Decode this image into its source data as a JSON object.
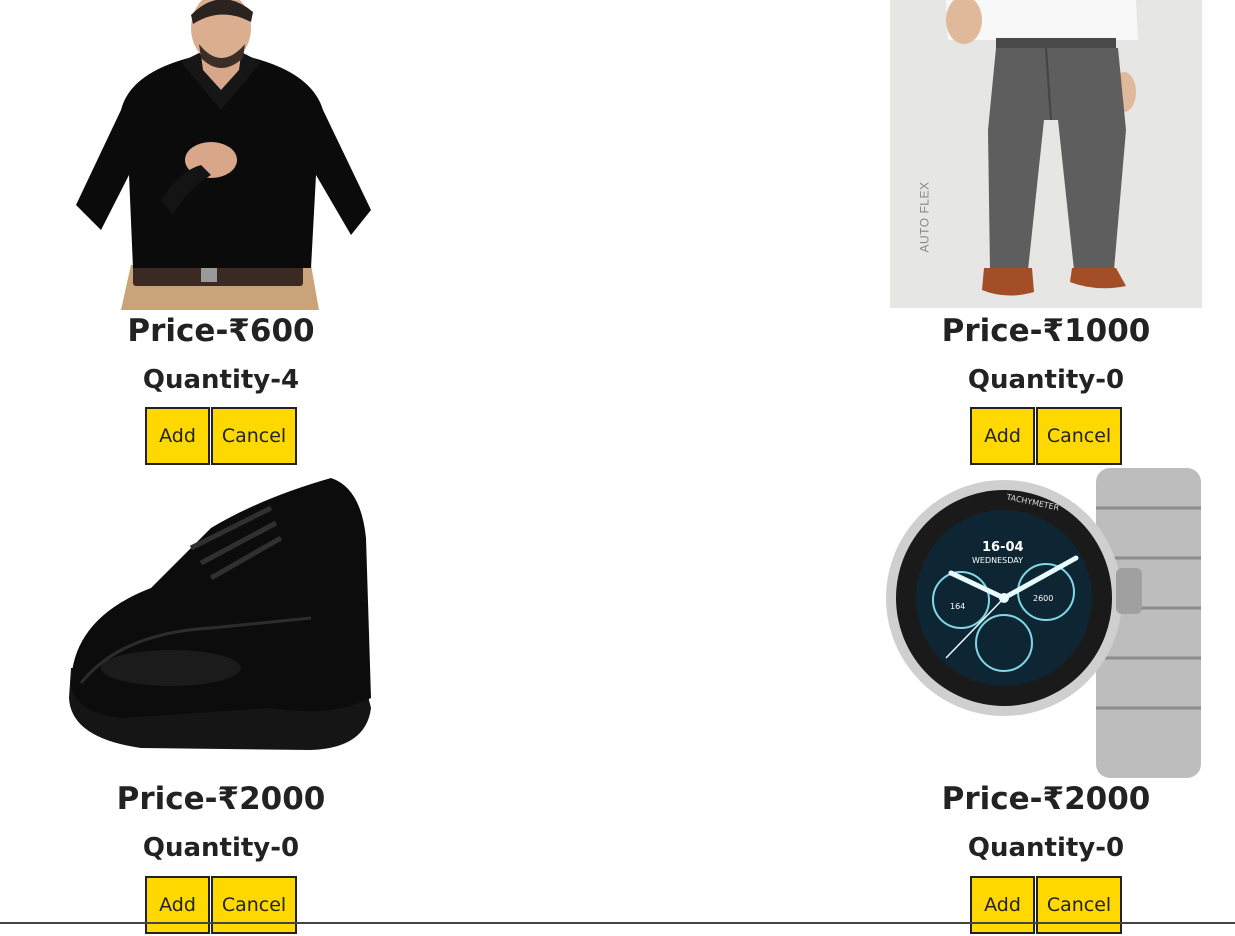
{
  "products": [
    {
      "name": "black-shirt",
      "price": "Price-₹600",
      "quantity": "Quantity-4",
      "add_label": "Add",
      "cancel_label": "Cancel"
    },
    {
      "name": "grey-trousers",
      "price": "Price-₹1000",
      "quantity": "Quantity-0",
      "add_label": "Add",
      "cancel_label": "Cancel",
      "image_text": "AUTO FLEX"
    },
    {
      "name": "black-formal-shoe",
      "price": "Price-₹2000",
      "quantity": "Quantity-0",
      "add_label": "Add",
      "cancel_label": "Cancel"
    },
    {
      "name": "silver-smartwatch",
      "price": "Price-₹2000",
      "quantity": "Quantity-0",
      "add_label": "Add",
      "cancel_label": "Cancel",
      "watch_face": {
        "time": "16-04",
        "day": "WEDNESDAY",
        "bezel": "TACHYMETER",
        "left_dial": "164",
        "right_dial": "2600"
      }
    }
  ],
  "colors": {
    "button_bg": "#ffd800",
    "button_border": "#222222",
    "text": "#222222"
  }
}
